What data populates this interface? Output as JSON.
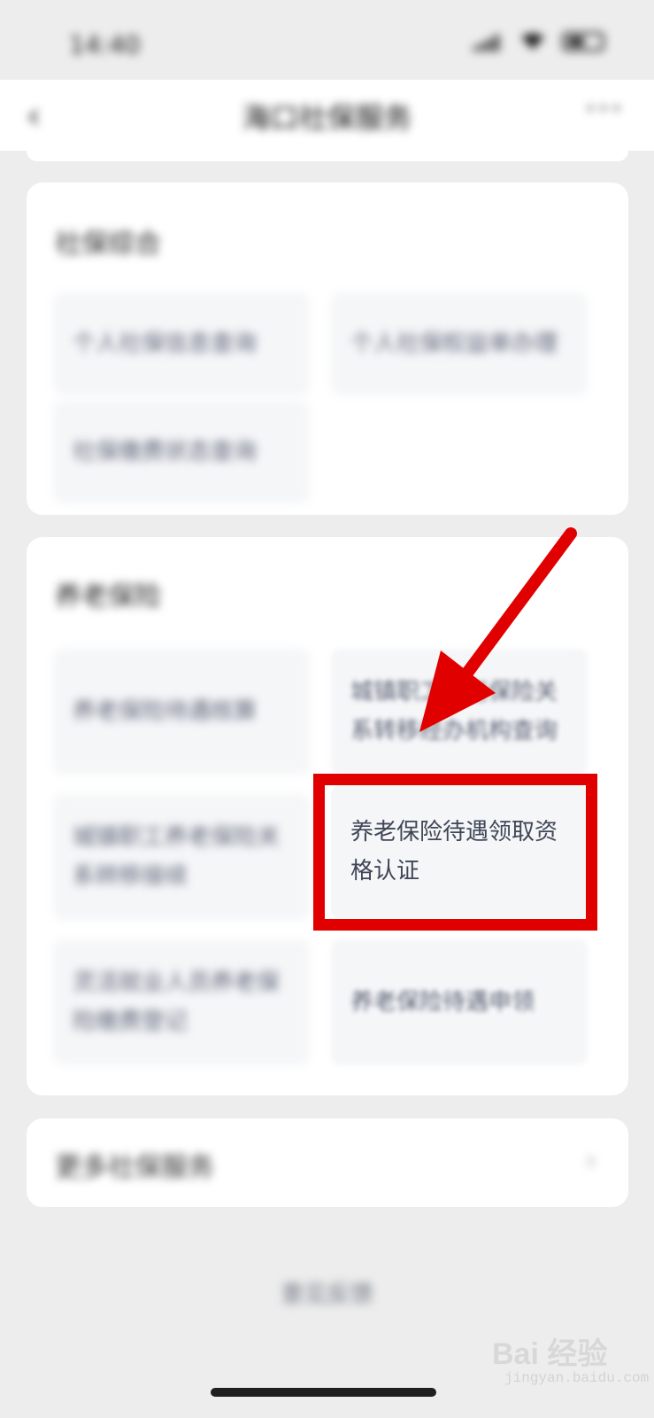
{
  "status_bar": {
    "time": "14:40"
  },
  "nav": {
    "back_icon": "chevron-left-icon",
    "title": "海口社保服务",
    "more_icon": "more-dots-icon"
  },
  "sections": {
    "social_insurance": {
      "title": "社保综合",
      "items": [
        "个人社保信息查询",
        "个人社保权益单办理",
        "社保缴费状态查询"
      ]
    },
    "pension": {
      "title": "养老保险",
      "items": [
        "养老保险待遇核算",
        "城镇职工养老保险关系转移经办机构查询",
        "城镇职工养老保险关系转移接续",
        "养老保险待遇领取资格认证",
        "灵活就业人员养老保险缴费登记",
        "养老保险待遇申领"
      ]
    },
    "more": {
      "label": "更多社保服务",
      "chevron_icon": "chevron-right-icon"
    }
  },
  "footer": {
    "link": "意见反馈"
  },
  "watermark": {
    "text": "Bai 经验",
    "sub": "jingyan.baidu.com"
  },
  "annotation": {
    "color": "#e10000",
    "highlighted_item": "养老保险待遇领取资格认证"
  }
}
